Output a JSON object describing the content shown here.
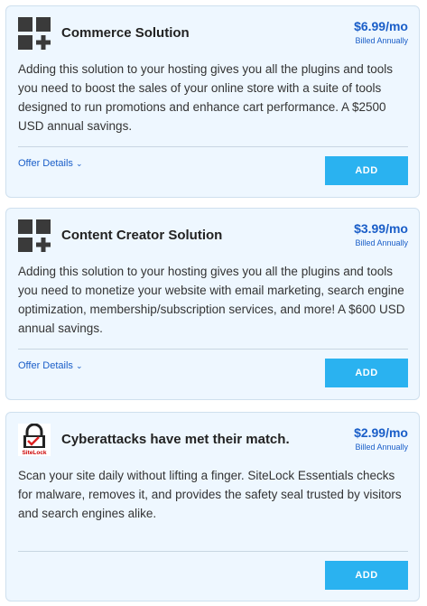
{
  "cards": [
    {
      "title": "Commerce Solution",
      "price": "$6.99/mo",
      "billing": "Billed Annually",
      "description": "Adding this solution to your hosting gives you all the plugins and tools you need to boost the sales of your online store with a suite of tools designed to run promotions and enhance cart performance. A $2500 USD annual savings.",
      "offer_details": "Offer Details",
      "add_label": "ADD",
      "icon": "grid-plus-icon"
    },
    {
      "title": "Content Creator Solution",
      "price": "$3.99/mo",
      "billing": "Billed Annually",
      "description": "Adding this solution to your hosting gives you all the plugins and tools you need to monetize your website with email marketing, search engine optimization, membership/subscription services, and more! A $600 USD annual savings.",
      "offer_details": "Offer Details",
      "add_label": "ADD",
      "icon": "grid-plus-icon"
    },
    {
      "title": "Cyberattacks have met their match.",
      "price": "$2.99/mo",
      "billing": "Billed Annually",
      "description": "Scan your site daily without lifting a finger. SiteLock Essentials checks for malware, removes it, and provides the safety seal trusted by visitors and search engines alike.",
      "add_label": "ADD",
      "icon": "sitelock-logo",
      "logo_text": "SiteLock"
    }
  ],
  "colors": {
    "card_bg": "#eef7ff",
    "accent": "#1a5ec8",
    "button": "#2ab2f0"
  }
}
